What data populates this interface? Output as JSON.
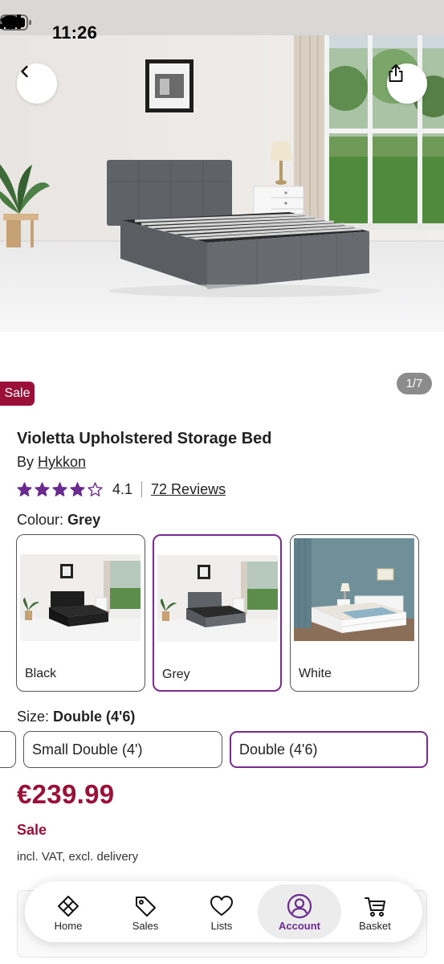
{
  "status_bar": {
    "time": "11:26"
  },
  "gallery": {
    "counter": "1/7",
    "sale_badge": "Sale"
  },
  "product": {
    "title": "Violetta Upholstered Storage Bed",
    "brand_prefix": "By",
    "brand": "Hykkon",
    "rating": 4.1,
    "rating_text": "4.1",
    "reviews": "72 Reviews"
  },
  "colour": {
    "label": "Colour:",
    "selected": "Grey",
    "options": [
      {
        "label": "Black"
      },
      {
        "label": "Grey"
      },
      {
        "label": "White"
      }
    ]
  },
  "size": {
    "label": "Size:",
    "selected": "Double (4'6)",
    "options": [
      {
        "label": "Small Double (4')"
      },
      {
        "label": "Double (4'6)"
      }
    ]
  },
  "pricing": {
    "price": "€239.99",
    "sale_label": "Sale",
    "vat_note": "incl. VAT, excl. delivery"
  },
  "tabbar": {
    "items": [
      {
        "label": "Home",
        "icon": "home-icon"
      },
      {
        "label": "Sales",
        "icon": "tag-icon"
      },
      {
        "label": "Lists",
        "icon": "heart-icon"
      },
      {
        "label": "Account",
        "icon": "account-icon"
      },
      {
        "label": "Basket",
        "icon": "basket-icon"
      }
    ],
    "active": "Account"
  },
  "colors": {
    "accent": "#7b2a91",
    "sale": "#9b1039"
  }
}
